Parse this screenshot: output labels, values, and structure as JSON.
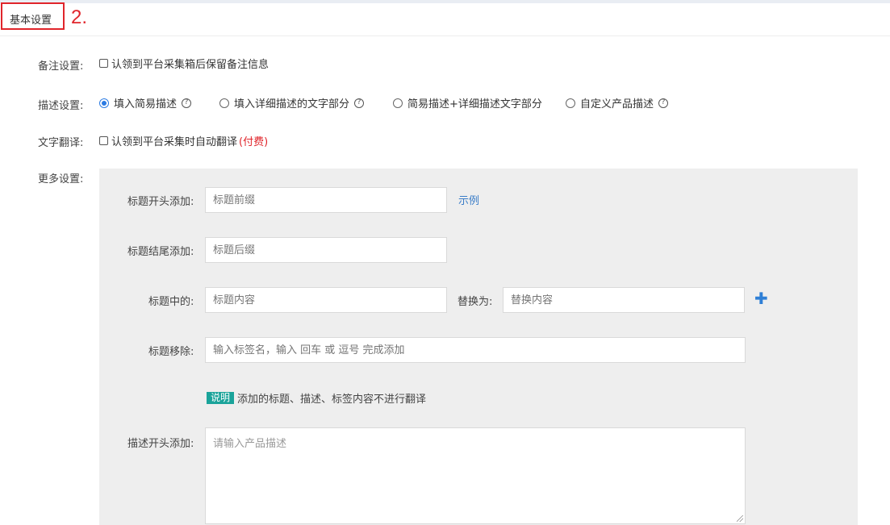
{
  "header": {
    "title": "基本设置",
    "annotation": "2."
  },
  "remark": {
    "label": "备注设置:",
    "checkbox_label": "认领到平台采集箱后保留备注信息",
    "checked": false
  },
  "description": {
    "label": "描述设置:",
    "options": [
      {
        "label": "填入简易描述",
        "checked": true,
        "help": true
      },
      {
        "label": "填入详细描述的文字部分",
        "checked": false,
        "help": true
      },
      {
        "label": "简易描述+详细描述文字部分",
        "checked": false,
        "help": false
      },
      {
        "label": "自定义产品描述",
        "checked": false,
        "help": true
      }
    ]
  },
  "translate": {
    "label": "文字翻译:",
    "checkbox_label": "认领到平台采集时自动翻译",
    "paid_label": "(付费)",
    "checked": false
  },
  "more": {
    "label": "更多设置:",
    "title_prefix": {
      "label": "标题开头添加:",
      "placeholder": "标题前缀",
      "example_link": "示例"
    },
    "title_suffix": {
      "label": "标题结尾添加:",
      "placeholder": "标题后缀"
    },
    "title_replace": {
      "label": "标题中的:",
      "placeholder": "标题内容",
      "replace_label": "替换为:",
      "replace_placeholder": "替换内容"
    },
    "title_remove": {
      "label": "标题移除:",
      "placeholder": "输入标签名，输入 回车 或 逗号 完成添加"
    },
    "note": {
      "badge": "说明",
      "text": "添加的标题、描述、标签内容不进行翻译"
    },
    "desc_prefix": {
      "label": "描述开头添加:",
      "placeholder": "请输入产品描述"
    }
  },
  "colors": {
    "accent": "#2a7ae2",
    "annotation": "#e0252b",
    "note_badge": "#1aa39a",
    "panel_bg": "#eeeeee"
  }
}
